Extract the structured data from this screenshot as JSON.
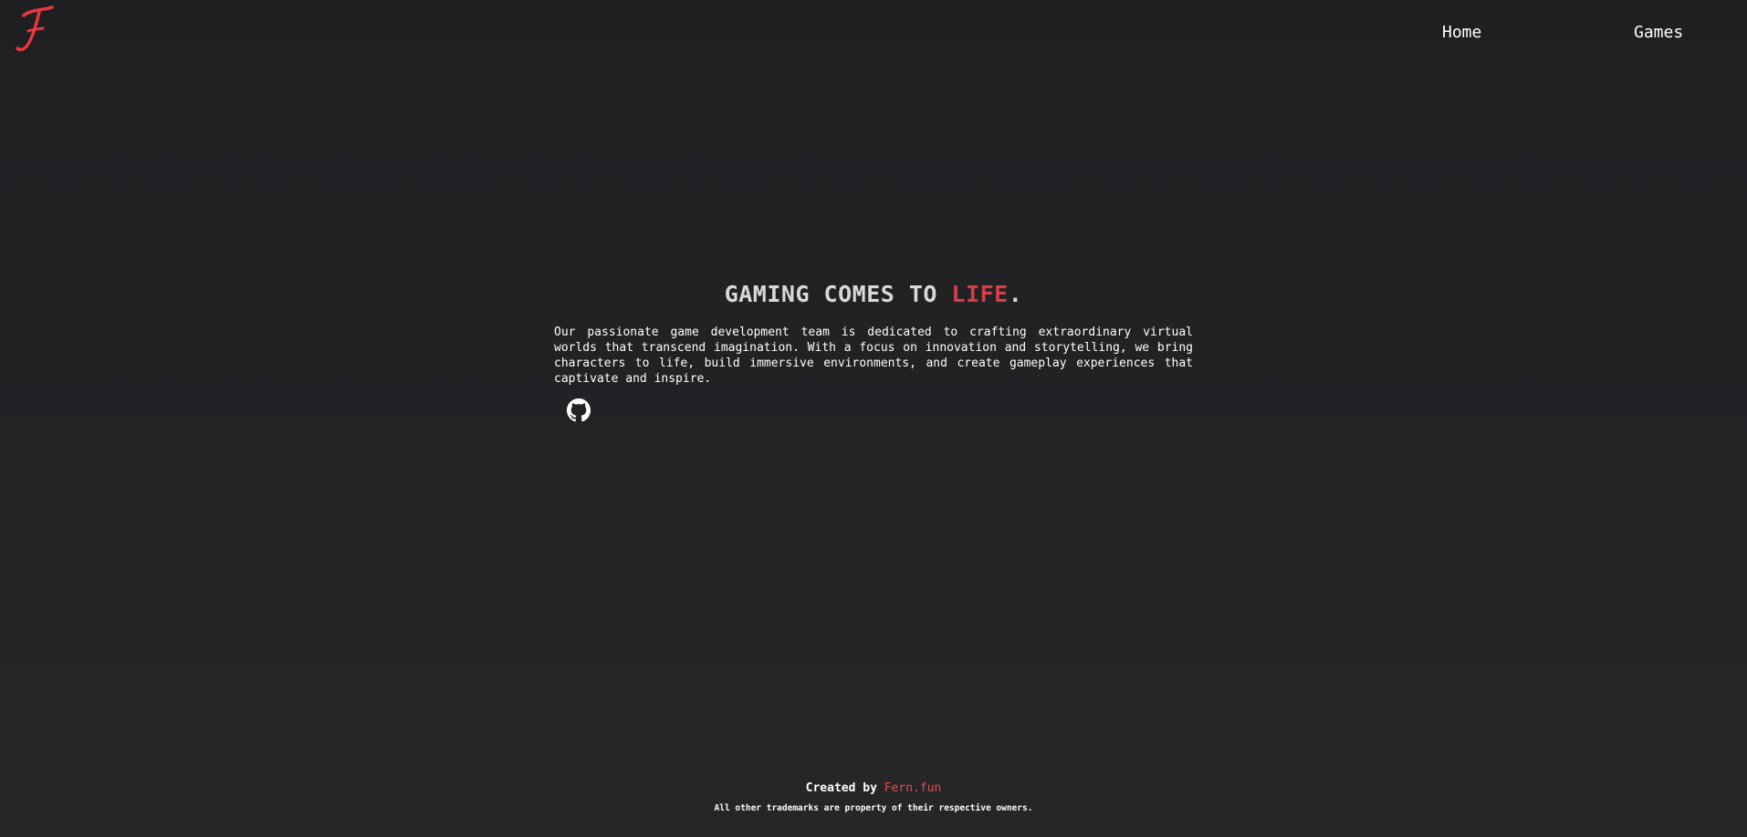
{
  "header": {
    "logo_icon": "fern-script-f-logo",
    "logo_letter": "F",
    "nav": {
      "home_label": "Home",
      "games_label": "Games"
    }
  },
  "hero": {
    "title_main": "GAMING COMES TO ",
    "title_accent": "LIFE",
    "title_end": ".",
    "description": "Our passionate game development team is dedicated to crafting extraordinary virtual worlds that transcend imagination. With a focus on innovation and storytelling, we bring characters to life, build immersive environments, and create gameplay experiences that captivate and inspire.",
    "social_icon": "github-icon"
  },
  "footer": {
    "created_prefix": "Created by ",
    "created_link": "Fern.fun",
    "trademark_note": "All other trademarks are property of their respective owners."
  },
  "colors": {
    "background": "#222225",
    "accent": "#d63e48",
    "text": "#ffffff"
  }
}
